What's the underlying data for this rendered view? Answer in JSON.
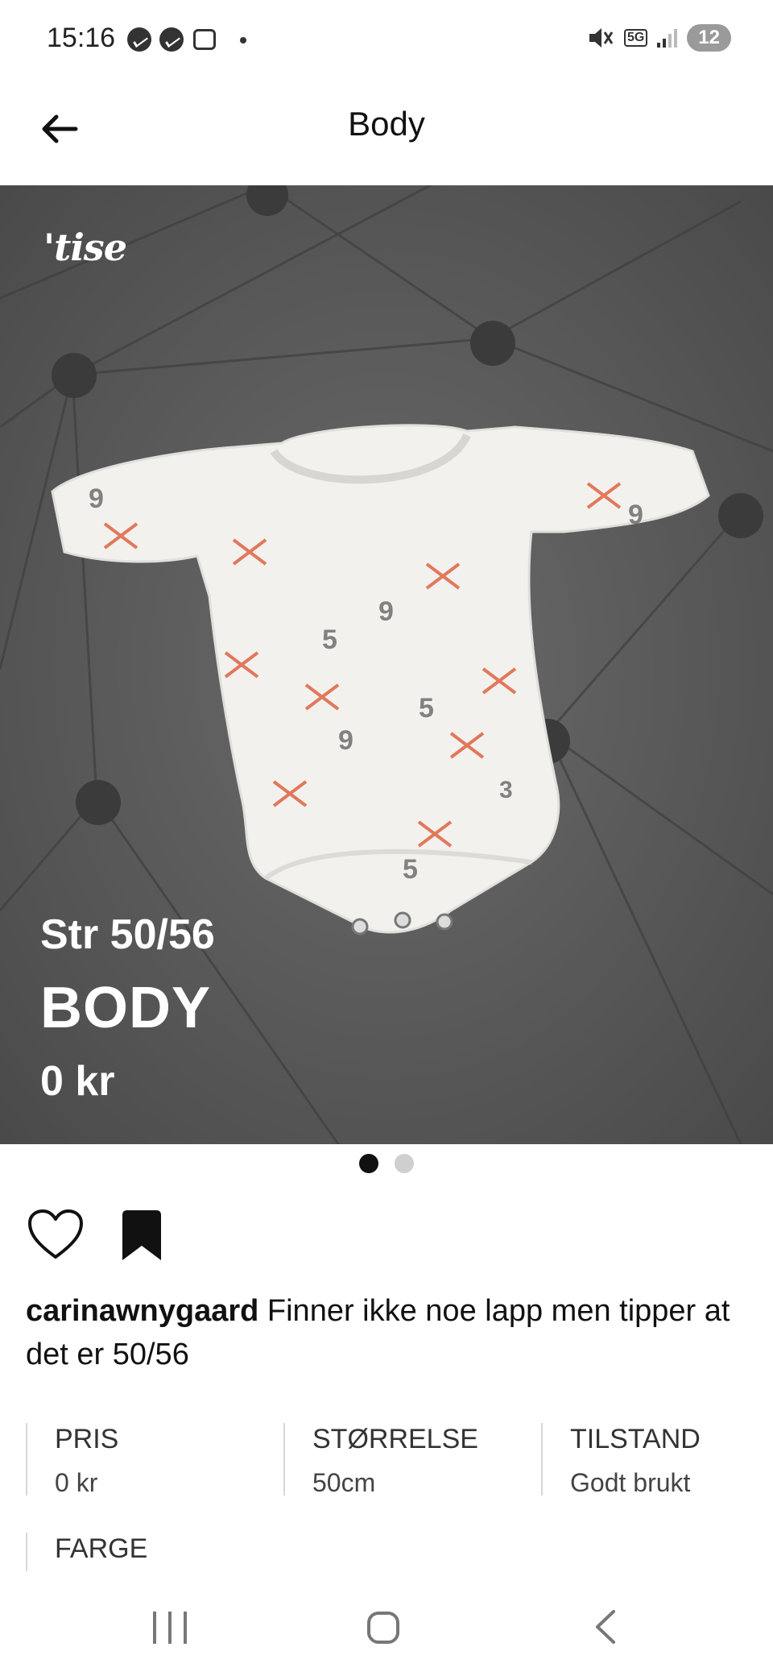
{
  "status_bar": {
    "time": "15:16",
    "network": "5G",
    "battery": "12"
  },
  "app_bar": {
    "title": "Body"
  },
  "hero": {
    "logo": "'tise",
    "size_text": "Str 50/56",
    "name_text": "BODY",
    "price_text": "0 kr",
    "page_count": 2,
    "active_page": 1
  },
  "post": {
    "username": "carinawnygaard",
    "caption": " Finner ikke noe lapp men tipper at det er 50/56"
  },
  "attributes": {
    "price": {
      "label": "PRIS",
      "value": "0 kr"
    },
    "size": {
      "label": "STØRRELSE",
      "value": "50cm"
    },
    "condition": {
      "label": "TILSTAND",
      "value": "Godt brukt"
    },
    "color": {
      "label": "FARGE",
      "value": ""
    }
  },
  "colors": {
    "background": "#ffffff",
    "text": "#111111",
    "overlay_text": "#ffffff",
    "active_dot": "#111111",
    "inactive_dot": "#cfcfcf"
  },
  "icons": [
    "messenger-icon",
    "screenshot-icon",
    "mute-icon",
    "signal-icon",
    "back-arrow-icon",
    "heart-icon",
    "bookmark-icon",
    "nav-recent-icon",
    "nav-home-icon",
    "nav-back-icon"
  ]
}
